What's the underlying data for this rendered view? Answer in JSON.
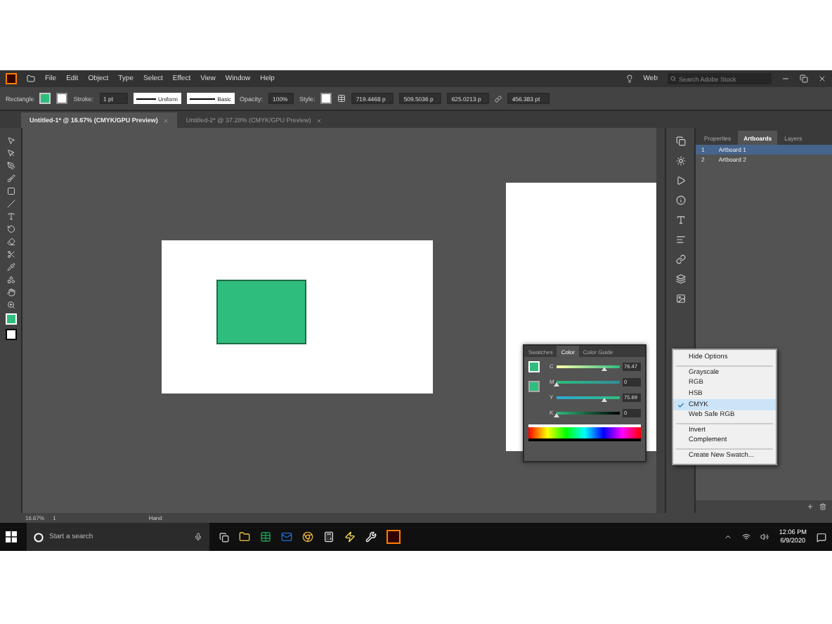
{
  "menu_bar": {
    "items": [
      "File",
      "Edit",
      "Object",
      "Type",
      "Select",
      "Effect",
      "View",
      "Window",
      "Help"
    ],
    "workspace": "Web",
    "search": {
      "placeholder": "Search Adobe Stock"
    }
  },
  "control_bar": {
    "tool": "Rectangle",
    "stroke_label": "Stroke:",
    "stroke_weight": "1 pt",
    "profile": "Uniform",
    "brush": "Basic",
    "opacity_label": "Opacity:",
    "opacity": "100%",
    "style_label": "Style:",
    "x": "719.4468 p",
    "y": "509.5036 p",
    "w": "625.0213 p",
    "h": "456.383 pt"
  },
  "tabs": [
    {
      "label": "Untitled-1* @ 16.67% (CMYK/GPU Preview)",
      "selected": true
    },
    {
      "label": "Untitled-2* @ 37.28% (CMYK/GPU Preview)",
      "selected": false
    }
  ],
  "panel": {
    "tabs": [
      {
        "label": "Properties",
        "selected": false
      },
      {
        "label": "Artboards",
        "selected": true
      },
      {
        "label": "Layers",
        "selected": false
      }
    ],
    "artboards": [
      {
        "number": "1",
        "name": "Artboard 1",
        "selected": true
      },
      {
        "number": "2",
        "name": "Artboard 2",
        "selected": false
      }
    ]
  },
  "color_panel": {
    "tabs": [
      {
        "label": "Swatches",
        "selected": false
      },
      {
        "label": "Color",
        "selected": true
      },
      {
        "label": "Color Guide",
        "selected": false
      }
    ],
    "channels": [
      {
        "name": "C",
        "level": 0.76,
        "value": "76.47"
      },
      {
        "name": "M",
        "level": 0,
        "value": "0"
      },
      {
        "name": "Y",
        "level": 0.76,
        "value": "75.69"
      },
      {
        "name": "K",
        "level": 0,
        "value": "0"
      }
    ]
  },
  "options_menu": {
    "groups": [
      [
        {
          "label": "Hide Options",
          "checked": false
        }
      ],
      [
        {
          "label": "Grayscale",
          "checked": false
        },
        {
          "label": "RGB",
          "checked": false
        },
        {
          "label": "HSB",
          "checked": false
        },
        {
          "label": "CMYK",
          "checked": true
        },
        {
          "label": "Web Safe RGB",
          "checked": false
        }
      ],
      [
        {
          "label": "Invert",
          "checked": false
        },
        {
          "label": "Complement",
          "checked": false
        }
      ],
      [
        {
          "label": "Create New Swatch...",
          "checked": false
        }
      ]
    ]
  },
  "status_bar": {
    "zoom": "16.67%",
    "artboard": "1",
    "tool": "Hand"
  },
  "taskbar": {
    "search": {
      "placeholder": "Start a search"
    },
    "time": "12:06 PM",
    "date": "6/9/2020"
  }
}
